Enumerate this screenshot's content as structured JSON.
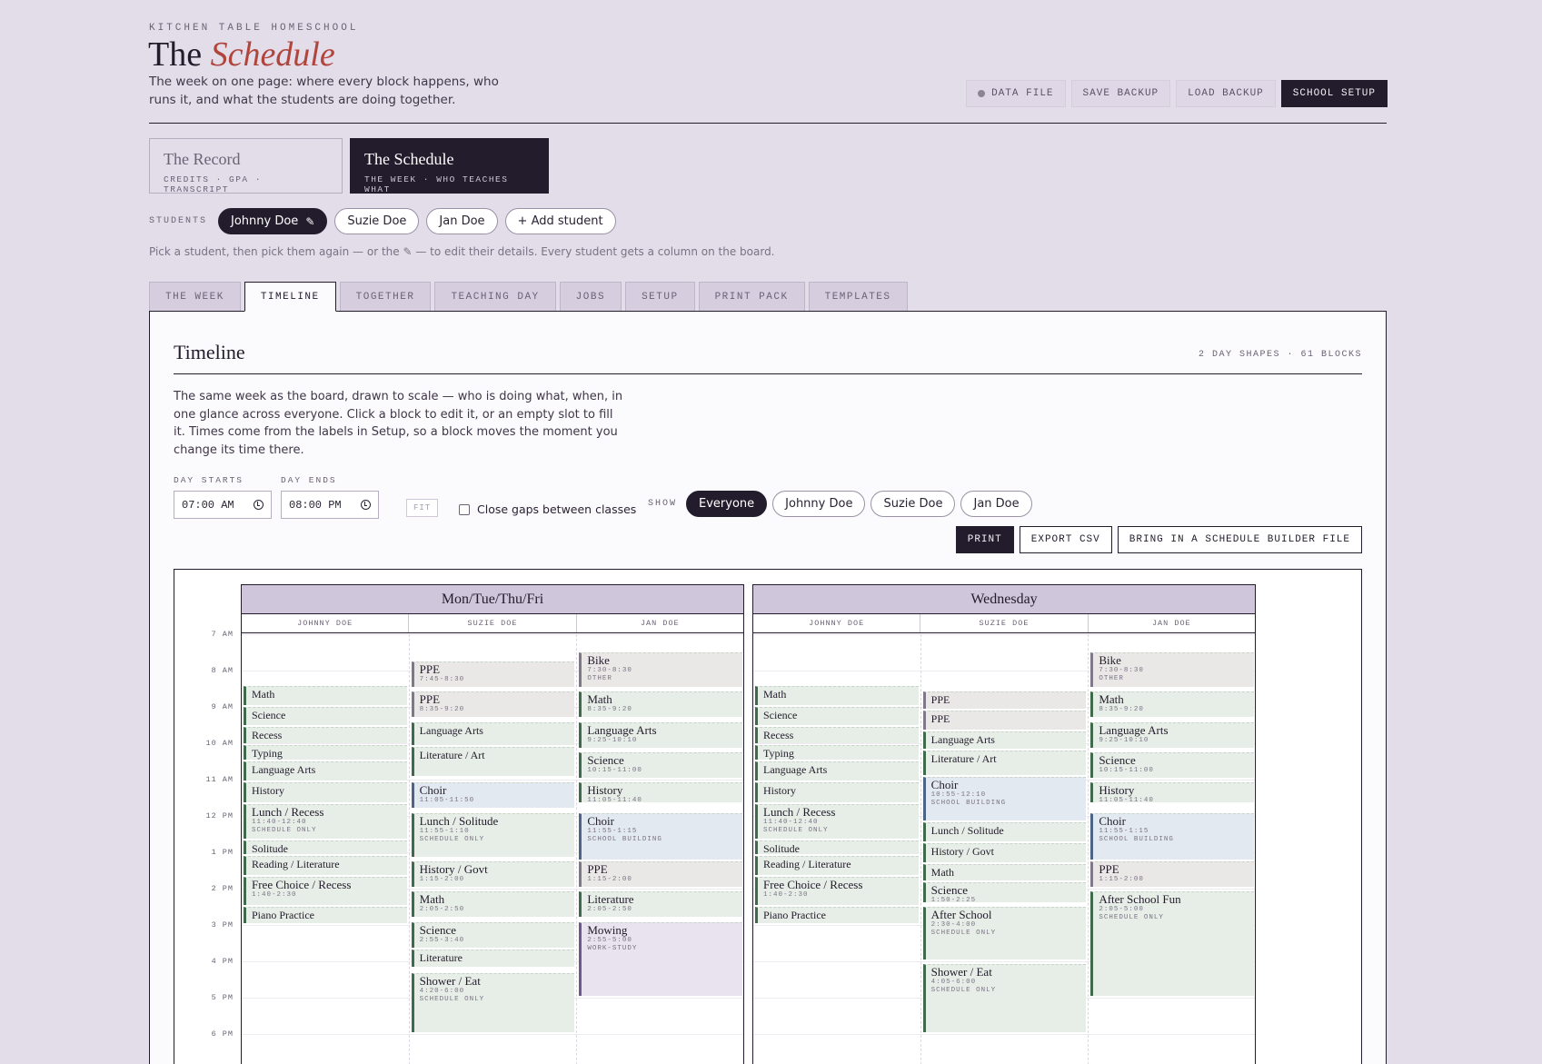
{
  "header": {
    "eyebrow": "KITCHEN TABLE HOMESCHOOL",
    "title_plain": "The",
    "title_accent": "Schedule",
    "tagline": "The week on one page: where every block happens, who runs it, and what the students are doing together."
  },
  "top_actions": {
    "data_file": "DATA FILE",
    "save_backup": "SAVE BACKUP",
    "load_backup": "LOAD BACKUP",
    "school_setup": "SCHOOL SETUP"
  },
  "switcher": {
    "record_title": "The Record",
    "record_sub": "CREDITS · GPA · TRANSCRIPT",
    "schedule_title": "The Schedule",
    "schedule_sub": "THE WEEK · WHO TEACHES WHAT"
  },
  "students": {
    "label": "STUDENTS",
    "items": [
      "Johnny Doe",
      "Suzie Doe",
      "Jan Doe"
    ],
    "edit_glyph": "✎",
    "add": "+ Add student",
    "hint": "Pick a student, then pick them again — or the ✎ — to edit their details. Every student gets a column on the board."
  },
  "tabs": [
    "THE WEEK",
    "TIMELINE",
    "TOGETHER",
    "TEACHING DAY",
    "JOBS",
    "SETUP",
    "PRINT PACK",
    "TEMPLATES"
  ],
  "panel": {
    "title": "Timeline",
    "stat": "2 DAY SHAPES · 61 BLOCKS",
    "description": "The same week as the board, drawn to scale — who is doing what, when, in one glance across everyone. Click a block to edit it, or an empty slot to fill it. Times come from the labels in Setup, so a block moves the moment you change its time there.",
    "day_starts_label": "DAY STARTS",
    "day_starts_value": "07:00 AM",
    "day_ends_label": "DAY ENDS",
    "day_ends_value": "08:00 PM",
    "fit": "FIT",
    "close_gaps": "Close gaps between classes",
    "show_label": "SHOW",
    "show_options": [
      "Everyone",
      "Johnny Doe",
      "Suzie Doe",
      "Jan Doe"
    ],
    "print": "PRINT",
    "export_csv": "EXPORT CSV",
    "import": "BRING IN A SCHEDULE BUILDER FILE"
  },
  "timeline": {
    "hours": [
      "7 AM",
      "8 AM",
      "9 AM",
      "10 AM",
      "11 AM",
      "12 PM",
      "1 PM",
      "2 PM",
      "3 PM",
      "4 PM",
      "5 PM",
      "6 PM"
    ],
    "groups": [
      {
        "title": "Mon/Tue/Thu/Fri",
        "students": [
          "JOHNNY DOE",
          "SUZIE DOE",
          "JAN DOE"
        ],
        "columns": [
          [
            {
              "name": "Math",
              "start": 8.42,
              "end": 9.0,
              "color": "green"
            },
            {
              "name": "Science",
              "start": 9.0,
              "end": 9.55,
              "color": "green"
            },
            {
              "name": "Recess",
              "start": 9.55,
              "end": 10.05,
              "color": "green"
            },
            {
              "name": "Typing",
              "start": 10.05,
              "end": 10.5,
              "color": "green"
            },
            {
              "name": "Language Arts",
              "start": 10.5,
              "end": 11.08,
              "color": "green"
            },
            {
              "name": "History",
              "start": 11.08,
              "end": 11.67,
              "color": "green"
            },
            {
              "name": "Lunch / Recess",
              "time": "11:40-12:40",
              "tag": "SCHEDULE ONLY",
              "start": 11.67,
              "end": 12.67,
              "color": "green",
              "big": true
            },
            {
              "name": "Solitude",
              "start": 12.67,
              "end": 13.1,
              "color": "green"
            },
            {
              "name": "Reading / Literature",
              "start": 13.1,
              "end": 13.67,
              "color": "green"
            },
            {
              "name": "Free Choice / Recess",
              "time": "1:40-2:30",
              "start": 13.67,
              "end": 14.5,
              "color": "green",
              "big": true
            },
            {
              "name": "Piano Practice",
              "start": 14.5,
              "end": 15.0,
              "color": "green"
            }
          ],
          [
            {
              "name": "PPE",
              "time": "7:45-8:30",
              "start": 7.75,
              "end": 8.5,
              "color": "gray",
              "big": true
            },
            {
              "name": "PPE",
              "time": "8:35-9:20",
              "start": 8.58,
              "end": 9.33,
              "color": "gray",
              "big": true
            },
            {
              "name": "Language Arts",
              "start": 9.42,
              "end": 10.1,
              "color": "green"
            },
            {
              "name": "Literature / Art",
              "start": 10.1,
              "end": 10.95,
              "color": "green"
            },
            {
              "name": "Choir",
              "time": "11:05-11:50",
              "start": 11.08,
              "end": 11.83,
              "color": "blue",
              "big": true
            },
            {
              "name": "Lunch / Solitude",
              "time": "11:55-1:10",
              "tag": "SCHEDULE ONLY",
              "start": 11.92,
              "end": 13.17,
              "color": "green",
              "big": true
            },
            {
              "name": "History / Govt",
              "time": "1:15-2:00",
              "start": 13.25,
              "end": 14.0,
              "color": "green",
              "big": true
            },
            {
              "name": "Math",
              "time": "2:05-2:50",
              "start": 14.08,
              "end": 14.83,
              "color": "green",
              "big": true
            },
            {
              "name": "Science",
              "time": "2:55-3:40",
              "start": 14.92,
              "end": 15.67,
              "color": "green",
              "big": true
            },
            {
              "name": "Literature",
              "start": 15.67,
              "end": 16.2,
              "color": "green"
            },
            {
              "name": "Shower / Eat",
              "time": "4:20-6:00",
              "tag": "SCHEDULE ONLY",
              "start": 16.33,
              "end": 18.0,
              "color": "green",
              "big": true
            }
          ],
          [
            {
              "name": "Bike",
              "time": "7:30-8:30",
              "tag": "OTHER",
              "start": 7.5,
              "end": 8.5,
              "color": "gray",
              "big": true
            },
            {
              "name": "Math",
              "time": "8:35-9:20",
              "start": 8.58,
              "end": 9.33,
              "color": "green",
              "big": true
            },
            {
              "name": "Language Arts",
              "time": "9:25-10:10",
              "start": 9.42,
              "end": 10.17,
              "color": "green",
              "big": true
            },
            {
              "name": "Science",
              "time": "10:15-11:00",
              "start": 10.25,
              "end": 11.0,
              "color": "green",
              "big": true
            },
            {
              "name": "History",
              "time": "11:05-11:40",
              "start": 11.08,
              "end": 11.67,
              "color": "green",
              "big": true
            },
            {
              "name": "Choir",
              "time": "11:55-1:15",
              "tag": "SCHOOL BUILDING",
              "start": 11.92,
              "end": 13.25,
              "color": "blue",
              "big": true
            },
            {
              "name": "PPE",
              "time": "1:15-2:00",
              "start": 13.25,
              "end": 14.0,
              "color": "gray",
              "big": true
            },
            {
              "name": "Literature",
              "time": "2:05-2:50",
              "start": 14.08,
              "end": 14.83,
              "color": "green",
              "big": true
            },
            {
              "name": "Mowing",
              "time": "2:55-5:00",
              "tag": "WORK-STUDY",
              "start": 14.92,
              "end": 17.0,
              "color": "purple",
              "big": true
            }
          ]
        ]
      },
      {
        "title": "Wednesday",
        "students": [
          "JOHNNY DOE",
          "SUZIE DOE",
          "JAN DOE"
        ],
        "columns": [
          [
            {
              "name": "Math",
              "start": 8.42,
              "end": 9.0,
              "color": "green"
            },
            {
              "name": "Science",
              "start": 9.0,
              "end": 9.55,
              "color": "green"
            },
            {
              "name": "Recess",
              "start": 9.55,
              "end": 10.05,
              "color": "green"
            },
            {
              "name": "Typing",
              "start": 10.05,
              "end": 10.5,
              "color": "green"
            },
            {
              "name": "Language Arts",
              "start": 10.5,
              "end": 11.08,
              "color": "green"
            },
            {
              "name": "History",
              "start": 11.08,
              "end": 11.67,
              "color": "green"
            },
            {
              "name": "Lunch / Recess",
              "time": "11:40-12:40",
              "tag": "SCHEDULE ONLY",
              "start": 11.67,
              "end": 12.67,
              "color": "green",
              "big": true
            },
            {
              "name": "Solitude",
              "start": 12.67,
              "end": 13.1,
              "color": "green"
            },
            {
              "name": "Reading / Literature",
              "start": 13.1,
              "end": 13.67,
              "color": "green"
            },
            {
              "name": "Free Choice / Recess",
              "time": "1:40-2:30",
              "start": 13.67,
              "end": 14.5,
              "color": "green",
              "big": true
            },
            {
              "name": "Piano Practice",
              "start": 14.5,
              "end": 15.0,
              "color": "green"
            }
          ],
          [
            {
              "name": "PPE",
              "start": 8.58,
              "end": 9.1,
              "color": "gray"
            },
            {
              "name": "PPE",
              "start": 9.1,
              "end": 9.67,
              "color": "gray"
            },
            {
              "name": "Language Arts",
              "start": 9.67,
              "end": 10.2,
              "color": "green"
            },
            {
              "name": "Literature / Art",
              "start": 10.2,
              "end": 10.92,
              "color": "green"
            },
            {
              "name": "Choir",
              "time": "10:55-12:10",
              "tag": "SCHOOL BUILDING",
              "start": 10.92,
              "end": 12.17,
              "color": "blue",
              "big": true
            },
            {
              "name": "Lunch / Solitude",
              "start": 12.17,
              "end": 12.75,
              "color": "green"
            },
            {
              "name": "History / Govt",
              "start": 12.75,
              "end": 13.33,
              "color": "green"
            },
            {
              "name": "Math",
              "start": 13.33,
              "end": 13.83,
              "color": "green"
            },
            {
              "name": "Science",
              "time": "1:50-2:25",
              "start": 13.83,
              "end": 14.42,
              "color": "green",
              "big": true
            },
            {
              "name": "After School",
              "time": "2:30-4:00",
              "tag": "SCHEDULE ONLY",
              "start": 14.5,
              "end": 16.0,
              "color": "green",
              "big": true
            },
            {
              "name": "Shower / Eat",
              "time": "4:05-6:00",
              "tag": "SCHEDULE ONLY",
              "start": 16.08,
              "end": 18.0,
              "color": "green",
              "big": true
            }
          ],
          [
            {
              "name": "Bike",
              "time": "7:30-8:30",
              "tag": "OTHER",
              "start": 7.5,
              "end": 8.5,
              "color": "gray",
              "big": true
            },
            {
              "name": "Math",
              "time": "8:35-9:20",
              "start": 8.58,
              "end": 9.33,
              "color": "green",
              "big": true
            },
            {
              "name": "Language Arts",
              "time": "9:25-10:10",
              "start": 9.42,
              "end": 10.17,
              "color": "green",
              "big": true
            },
            {
              "name": "Science",
              "time": "10:15-11:00",
              "start": 10.25,
              "end": 11.0,
              "color": "green",
              "big": true
            },
            {
              "name": "History",
              "time": "11:05-11:40",
              "start": 11.08,
              "end": 11.67,
              "color": "green",
              "big": true
            },
            {
              "name": "Choir",
              "time": "11:55-1:15",
              "tag": "SCHOOL BUILDING",
              "start": 11.92,
              "end": 13.25,
              "color": "blue",
              "big": true
            },
            {
              "name": "PPE",
              "time": "1:15-2:00",
              "start": 13.25,
              "end": 14.0,
              "color": "gray",
              "big": true
            },
            {
              "name": "After School Fun",
              "time": "2:05-5:00",
              "tag": "SCHEDULE ONLY",
              "start": 14.08,
              "end": 17.0,
              "color": "green",
              "big": true
            }
          ]
        ]
      }
    ]
  }
}
